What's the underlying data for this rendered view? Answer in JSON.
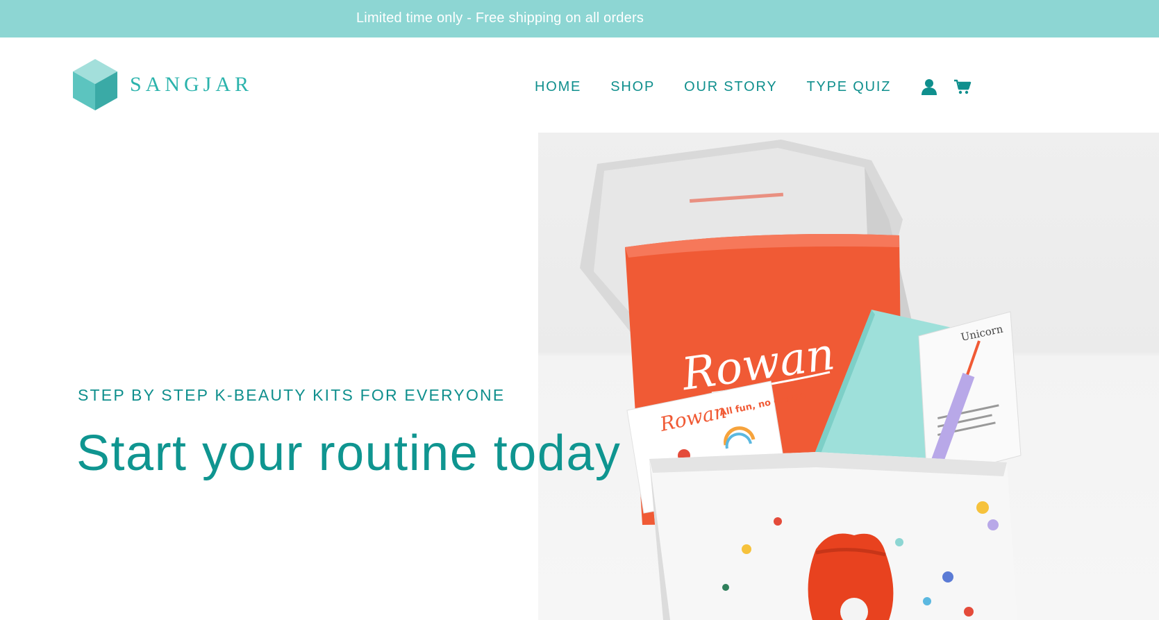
{
  "announcement": {
    "text": "Limited time only - Free shipping on all orders"
  },
  "header": {
    "logo_text": "SANGJAR",
    "nav": [
      {
        "label": "HOME"
      },
      {
        "label": "SHOP"
      },
      {
        "label": "OUR STORY"
      },
      {
        "label": "TYPE QUIZ"
      }
    ],
    "icons": [
      "account-icon",
      "cart-icon"
    ]
  },
  "hero": {
    "subtitle": "STEP BY STEP K-BEAUTY KITS FOR EVERYONE",
    "title": "Start your routine today",
    "image": {
      "bag_brand": "Rowan",
      "sticker_brand": "Rowan",
      "sticker_slogan": "All fun, no drama",
      "card_title": "Unicorn"
    }
  },
  "colors": {
    "announcement_bg": "#8dd6d3",
    "brand_teal": "#0f8f8d",
    "logo_teal": "#2bb3ac",
    "bag_orange": "#f05a35"
  }
}
